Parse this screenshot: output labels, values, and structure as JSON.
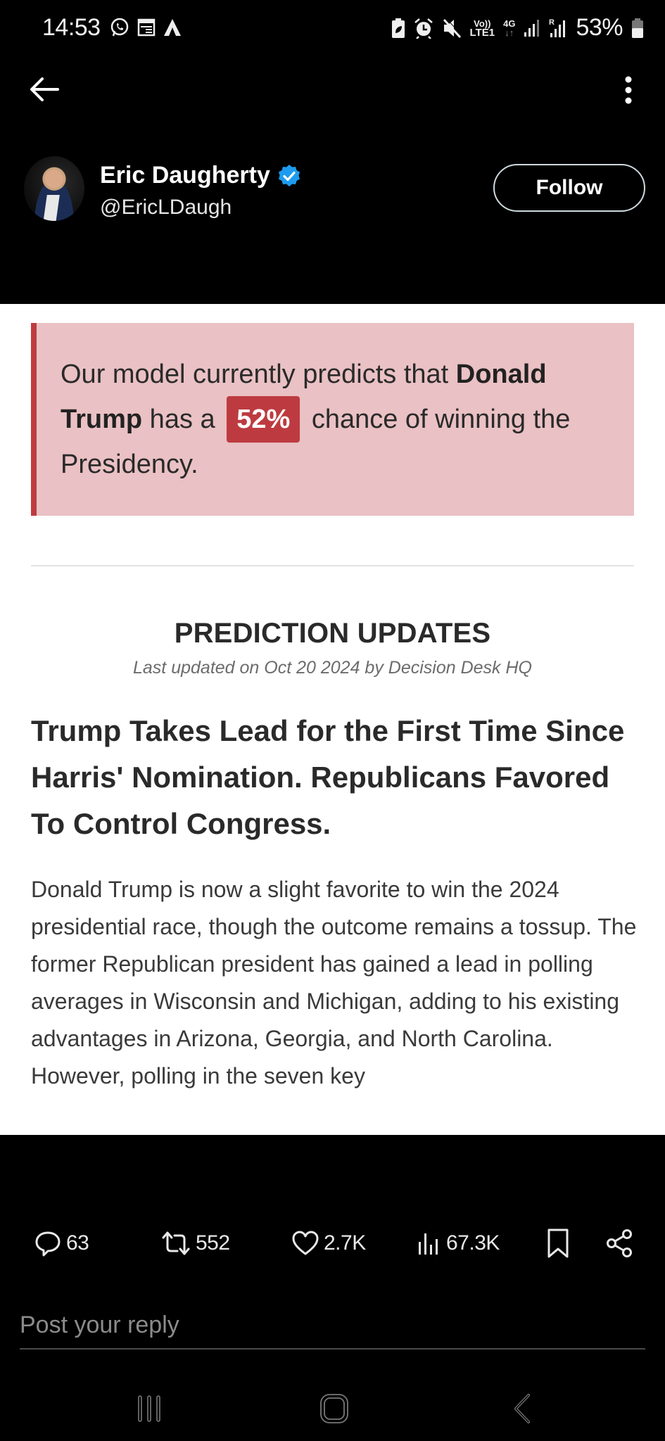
{
  "status_bar": {
    "time": "14:53",
    "left_icons": [
      "whatsapp-icon",
      "calendar-news-icon",
      "arrow-app-icon"
    ],
    "right_icons": [
      "battery-saver-icon",
      "alarm-icon",
      "mute-icon",
      "volte-icon",
      "4g-data-icon",
      "signal-icon",
      "roaming-signal-icon"
    ],
    "volte_label_top": "Vo))",
    "volte_label_bottom": "LTE1",
    "network_label": "4G",
    "roaming_label": "R",
    "battery_percent": "53%"
  },
  "top_bar": {
    "back_icon": "back-arrow-icon",
    "more_icon": "more-vertical-icon"
  },
  "author": {
    "name": "Eric Daugherty",
    "handle": "@EricLDaugh",
    "verified": true,
    "follow_label": "Follow"
  },
  "media": {
    "callout": {
      "text_before": "Our model currently predicts that ",
      "candidate": "Donald Trump",
      "text_middle": " has a ",
      "percent": "52%",
      "text_after": " chance of winning the Presidency."
    },
    "section_title": "PREDICTION UPDATES",
    "section_subtitle": "Last updated on Oct 20 2024 by Decision Desk HQ",
    "headline": "Trump Takes Lead for the First Time Since Harris' Nomination. Republicans Favored To Control Congress.",
    "body": "Donald Trump is now a slight favorite to win the 2024 presidential race, though the outcome remains a tossup. The former Republican president has gained a lead in polling averages in Wisconsin and Michigan, adding to his existing advantages in Arizona, Georgia, and North Carolina. However, polling in the seven key",
    "colors": {
      "callout_bg": "#eac1c4",
      "accent_red": "#bd3b40"
    }
  },
  "actions": {
    "replies": "63",
    "reposts": "552",
    "likes": "2.7K",
    "views": "67.3K"
  },
  "reply": {
    "placeholder": "Post your reply"
  },
  "nav_bar": {
    "buttons": [
      "recent-apps-icon",
      "home-icon",
      "back-icon"
    ]
  }
}
